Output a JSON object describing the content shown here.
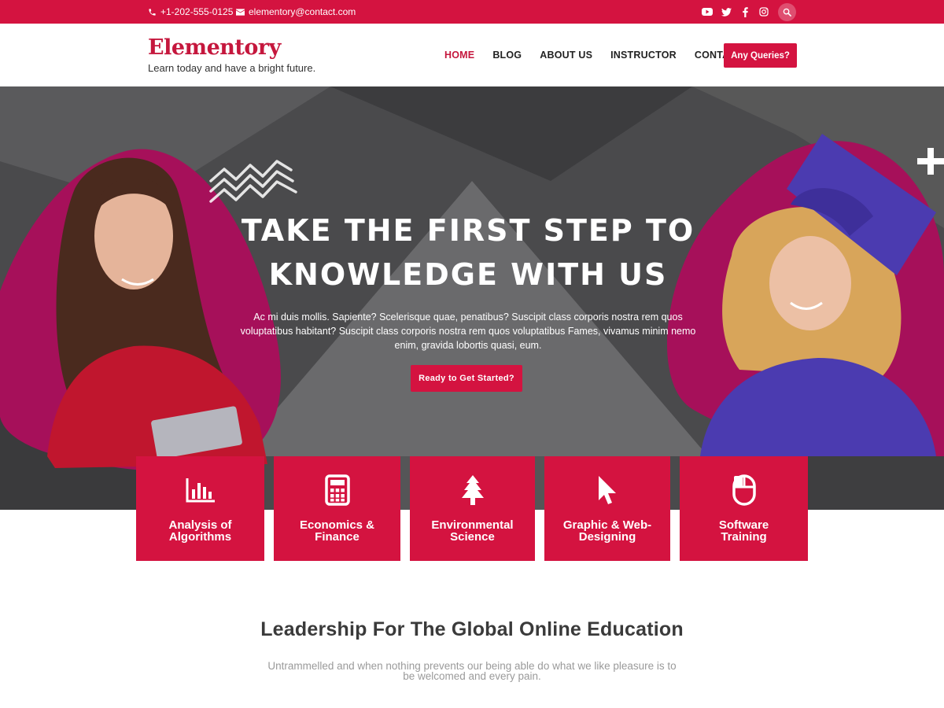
{
  "topbar": {
    "phone": "+1-202-555-0125",
    "email": "elementory@contact.com",
    "social_icons": [
      "youtube-icon",
      "twitter-icon",
      "facebook-icon",
      "instagram-icon"
    ],
    "search_icon": "search-icon"
  },
  "header": {
    "logo": "Elementory",
    "tagline": "Learn today and have a bright future.",
    "nav": [
      {
        "label": "HOME",
        "active": true
      },
      {
        "label": "BLOG",
        "active": false
      },
      {
        "label": "ABOUT US",
        "active": false
      },
      {
        "label": "INSTRUCTOR",
        "active": false
      },
      {
        "label": "CONTACT",
        "active": false
      }
    ],
    "cta": "Any Queries?"
  },
  "hero": {
    "title_line1": "TAKE THE FIRST STEP TO",
    "title_line2": "KNOWLEDGE WITH US",
    "text": "Ac mi duis mollis. Sapiente? Scelerisque quae, penatibus? Suscipit class corporis nostra rem quos voluptatibus habitant? Suscipit class corporis nostra rem quos voluptatibus Fames, vivamus minim nemo enim, gravida lobortis quasi, eum.",
    "button": "Ready to Get Started?"
  },
  "cards": [
    {
      "line1": "Analysis of",
      "line2": "Algorithms",
      "icon": "bar-chart-icon"
    },
    {
      "line1": "Economics &",
      "line2": "Finance",
      "icon": "calculator-icon"
    },
    {
      "line1": "Environmental",
      "line2": "Science",
      "icon": "tree-icon"
    },
    {
      "line1": "Graphic & Web-",
      "line2": "Designing",
      "icon": "cursor-icon"
    },
    {
      "line1": "Software",
      "line2": "Training",
      "icon": "mouse-icon"
    }
  ],
  "section": {
    "title": "Leadership For The Global Online Education",
    "subtitle_line1": "Untrammelled and when nothing prevents our being able do what we like pleasure is to",
    "subtitle_line2": "be welcomed and every pain."
  },
  "colors": {
    "brand": "#d41340",
    "hero_bg": "#4a4a4c",
    "blob": "#a6105a"
  }
}
